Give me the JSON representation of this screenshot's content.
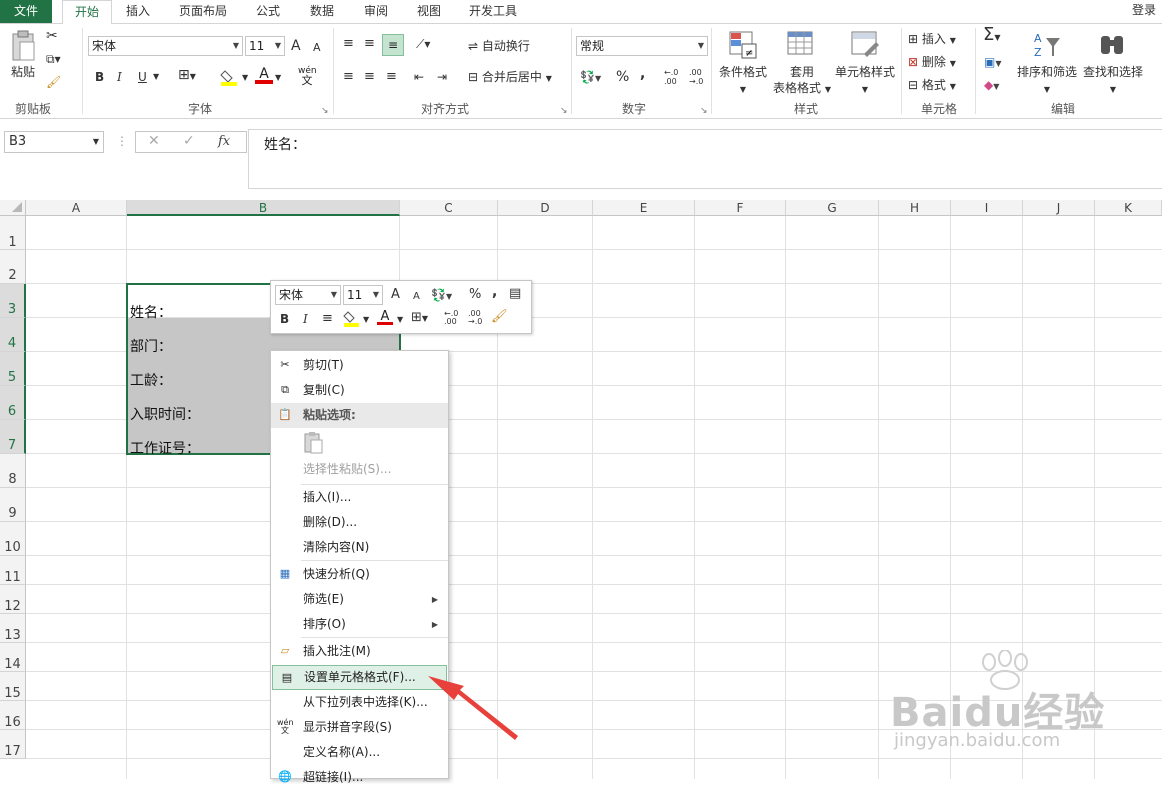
{
  "tabs": [
    "文件",
    "开始",
    "插入",
    "页面布局",
    "公式",
    "数据",
    "审阅",
    "视图",
    "开发工具"
  ],
  "login": "登录",
  "ribbon": {
    "clipboard": {
      "paste": "粘贴",
      "label": "剪贴板"
    },
    "font": {
      "name": "宋体",
      "size": "11",
      "label": "字体",
      "bold": "B",
      "italic": "I",
      "underline": "U",
      "grow": "A",
      "shrink": "A",
      "font_color": "A",
      "pinyin_top": "wén",
      "pinyin_bottom": "文"
    },
    "align": {
      "wrap": "自动换行",
      "merge": "合并后居中",
      "label": "对齐方式"
    },
    "number": {
      "format": "常规",
      "percent": "%",
      "comma": ",",
      "inc": "←.0\n.00",
      "dec": ".00\n→.0",
      "label": "数字"
    },
    "styles": {
      "cond": "条件格式",
      "table_top": "套用",
      "table_bottom": "表格格式",
      "cell": "单元格样式",
      "label": "样式"
    },
    "cells": {
      "insert": "插入",
      "delete": "删除",
      "format": "格式",
      "label": "单元格"
    },
    "edit": {
      "sigma": "Σ",
      "sort": "排序和筛选",
      "find": "查找和选择",
      "label": "编辑"
    }
  },
  "formula_bar": {
    "name_box": "B3",
    "content": "姓名：",
    "fx": "fx"
  },
  "columns": [
    "A",
    "B",
    "C",
    "D",
    "E",
    "F",
    "G",
    "H",
    "I",
    "J",
    "K"
  ],
  "rows": [
    "1",
    "2",
    "3",
    "4",
    "5",
    "6",
    "7",
    "8",
    "9",
    "10",
    "11",
    "12",
    "13",
    "14",
    "15",
    "16",
    "17"
  ],
  "cells": {
    "b3": "姓名：",
    "b4": "部门：",
    "b5": "工龄：",
    "b6": "入职时间：",
    "b7": "工作证号："
  },
  "mini_toolbar": {
    "font": "宋体",
    "size": "11",
    "bold": "B",
    "italic": "I",
    "percent": "%",
    "comma": ",",
    "grow": "A",
    "shrink": "A",
    "font_color": "A"
  },
  "context_menu": {
    "cut": "剪切(T)",
    "copy": "复制(C)",
    "paste_options": "粘贴选项:",
    "paste_special": "选择性粘贴(S)...",
    "insert": "插入(I)...",
    "delete": "删除(D)...",
    "clear": "清除内容(N)",
    "quick_analysis": "快速分析(Q)",
    "filter": "筛选(E)",
    "sort": "排序(O)",
    "insert_comment": "插入批注(M)",
    "format_cells": "设置单元格格式(F)...",
    "pick_list": "从下拉列表中选择(K)...",
    "phonetic": "显示拼音字段(S)",
    "define_name": "定义名称(A)...",
    "hyperlink": "超链接(I)..."
  },
  "watermark": {
    "brand": "Baidu经验",
    "url": "jingyan.baidu.com"
  },
  "colors": {
    "excel_green": "#217346",
    "selection": "#c6c6c6",
    "arrow": "#e8403a",
    "highlight": "#dff0e6"
  }
}
